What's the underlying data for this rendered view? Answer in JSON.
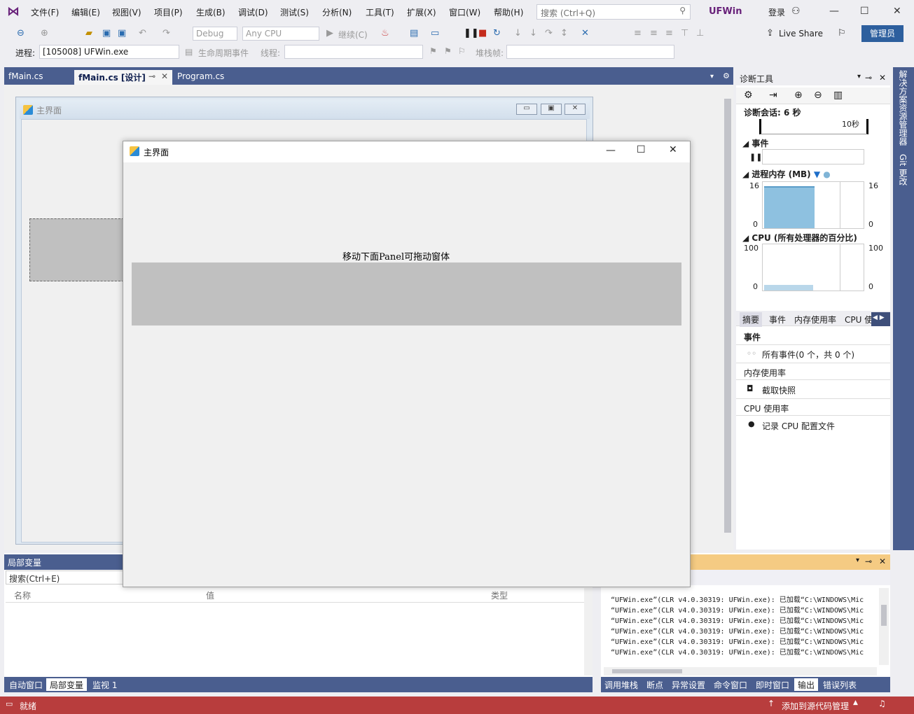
{
  "menubar": {
    "items": [
      "文件(F)",
      "编辑(E)",
      "视图(V)",
      "项目(P)",
      "生成(B)",
      "调试(D)",
      "测试(S)",
      "分析(N)",
      "工具(T)",
      "扩展(X)",
      "窗口(W)",
      "帮助(H)"
    ],
    "search_placeholder": "搜索 (Ctrl+Q)",
    "app_title": "UFWin",
    "login": "登录"
  },
  "toolbar": {
    "config": "Debug",
    "platform": "Any CPU",
    "continue": "继续(C)",
    "live_share": "Live Share",
    "admin": "管理员"
  },
  "toolbar2": {
    "process_label": "进程:",
    "process_value": "[105008] UFWin.exe",
    "lifecycle": "生命周期事件",
    "thread_label": "线程:",
    "stack_label": "堆栈帧:"
  },
  "tabs": [
    {
      "label": "fMain.cs"
    },
    {
      "label": "fMain.cs [设计]"
    },
    {
      "label": "Program.cs"
    }
  ],
  "designer": {
    "form_title": "主界面"
  },
  "running_window": {
    "title": "主界面",
    "label": "移动下面Panel可拖动窗体"
  },
  "diagnostics": {
    "title": "诊断工具",
    "session": "诊断会话: 6 秒",
    "timeline_label": "10秒",
    "events": "事件",
    "memory": "进程内存 (MB)",
    "mem_max": "16",
    "mem_min": "0",
    "cpu": "CPU (所有处理器的百分比)",
    "cpu_max": "100",
    "cpu_min": "0",
    "subtabs": [
      "摘要",
      "事件",
      "内存使用率",
      "CPU 使"
    ],
    "sec_events": "事件",
    "all_events": "所有事件(0 个，共 0 个)",
    "sec_memory": "内存使用率",
    "snapshot": "截取快照",
    "sec_cpu": "CPU 使用率",
    "record_cpu": "记录 CPU 配置文件"
  },
  "sidebar": {
    "solution": "解决方案资源管理器",
    "git": "Git 更改"
  },
  "locals": {
    "title": "局部变量",
    "search": "搜索(Ctrl+E)",
    "col_name": "名称",
    "col_value": "值",
    "col_type": "类型"
  },
  "bottom_left_tabs": [
    "自动窗口",
    "局部变量",
    "监视 1"
  ],
  "output": {
    "lines": [
      "“UFWin.exe”(CLR v4.0.30319: UFWin.exe): 已加载“C:\\WINDOWS\\Mic",
      "“UFWin.exe”(CLR v4.0.30319: UFWin.exe): 已加载“C:\\WINDOWS\\Mic",
      "“UFWin.exe”(CLR v4.0.30319: UFWin.exe): 已加载“C:\\WINDOWS\\Mic",
      "“UFWin.exe”(CLR v4.0.30319: UFWin.exe): 已加载“C:\\WINDOWS\\Mic",
      "“UFWin.exe”(CLR v4.0.30319: UFWin.exe): 已加载“C:\\WINDOWS\\Mic",
      "“UFWin.exe”(CLR v4.0.30319: UFWin.exe): 已加载“C:\\WINDOWS\\Mic"
    ]
  },
  "bottom_right_tabs": [
    "调用堆栈",
    "断点",
    "异常设置",
    "命令窗口",
    "即时窗口",
    "输出",
    "错误列表"
  ],
  "status": {
    "ready": "就绪",
    "source_control": "添加到源代码管理"
  },
  "colors": {
    "accent": "#68217a",
    "tab_strip": "#4a5e8f",
    "status_bar": "#b83d3d",
    "output_header": "#f5cb83"
  }
}
